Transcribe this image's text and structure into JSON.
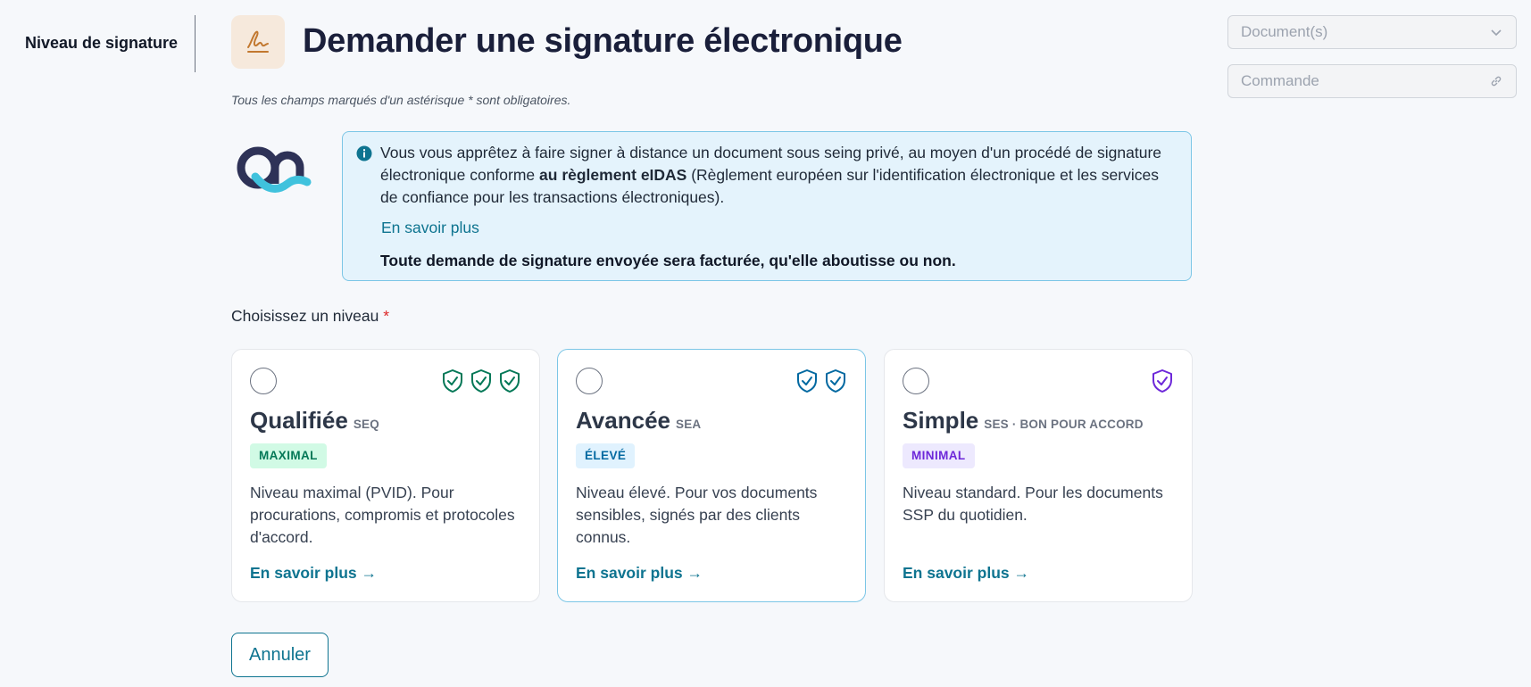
{
  "sidebar": {
    "step_label": "Niveau de signature"
  },
  "header": {
    "title": "Demander une signature électronique",
    "required_note": "Tous les champs marqués d'un astérisque * sont obligatoires."
  },
  "fields": {
    "documents_placeholder": "Document(s)",
    "commande_placeholder": "Commande"
  },
  "info": {
    "text_before": "Vous vous apprêtez à faire signer à distance un document sous seing privé, au moyen d'un procédé de signature électronique conforme ",
    "text_bold": "au règlement eIDAS",
    "text_after": " (Règlement européen sur l'identification électronique et les services de confiance pour les transactions électroniques).",
    "link": "En savoir plus",
    "warning": "Toute demande de signature envoyée sera facturée, qu'elle aboutisse ou non."
  },
  "choose": {
    "label": "Choisissez un niveau",
    "required_mark": "*"
  },
  "levels": [
    {
      "name": "Qualifiée",
      "code": "SEQ",
      "badge": "MAXIMAL",
      "description": "Niveau maximal (PVID). Pour procurations, compromis et protocoles d'accord.",
      "link": "En savoir plus →",
      "shield_count": 3,
      "color": "#047857",
      "selected": false
    },
    {
      "name": "Avancée",
      "code": "SEA",
      "badge": "ÉLEVÉ",
      "description": "Niveau élevé. Pour vos documents sensibles, signés par des clients connus.",
      "link": "En savoir plus →",
      "shield_count": 2,
      "color": "#0369a1",
      "selected": false
    },
    {
      "name": "Simple",
      "code": "SES · BON POUR ACCORD",
      "badge": "MINIMAL",
      "description": "Niveau standard. Pour les documents SSP du quotidien.",
      "link": "En savoir plus →",
      "shield_count": 1,
      "color": "#6d28d9",
      "selected": false
    }
  ],
  "actions": {
    "cancel": "Annuler"
  },
  "colors": {
    "accent": "#0e7490",
    "info_bg": "#e4f3fc",
    "info_border": "#7cc6e6"
  }
}
